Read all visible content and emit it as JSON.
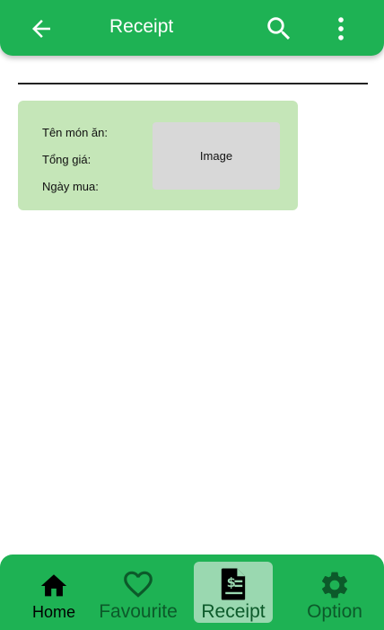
{
  "app_bar": {
    "title": "Receipt",
    "back_icon": "arrow-left-icon",
    "search_icon": "search-icon",
    "more_icon": "more-vert-icon"
  },
  "receipt_card": {
    "name_label": "Tên món ăn:",
    "total_label": "Tổng giá:",
    "date_label": "Ngày mua:",
    "image_placeholder": "Image"
  },
  "bottom_nav": {
    "items": [
      {
        "label": "Home",
        "icon": "home-icon"
      },
      {
        "label": "Favourite",
        "icon": "heart-icon"
      },
      {
        "label": "Receipt",
        "icon": "receipt-icon"
      },
      {
        "label": "Option",
        "icon": "gear-icon"
      }
    ],
    "active_index": 2
  },
  "colors": {
    "primary": "#1eb254",
    "card_bg": "#c5e6b8",
    "active_tab_bg": "#9ad8b0",
    "nav_label": "#0c5a2a"
  }
}
